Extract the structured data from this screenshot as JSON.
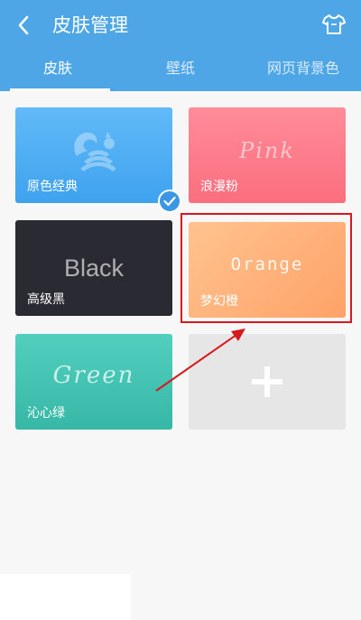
{
  "header": {
    "title": "皮肤管理",
    "back_icon": "chevron-left-icon",
    "shirt_icon": "tshirt-icon",
    "bg_color": "#4ea6e7"
  },
  "tabs": [
    {
      "label": "皮肤",
      "active": true
    },
    {
      "label": "壁纸",
      "active": false
    },
    {
      "label": "网页背景色",
      "active": false
    }
  ],
  "skins": [
    {
      "label": "原色经典",
      "art": "",
      "selected": true,
      "color": "#4ea8f2"
    },
    {
      "label": "浪漫粉",
      "art": "Pink",
      "selected": false,
      "color": "#fb7b8a"
    },
    {
      "label": "高级黑",
      "art": "Black",
      "selected": false,
      "color": "#2a2a33"
    },
    {
      "label": "梦幻橙",
      "art": "Orange",
      "selected": false,
      "color": "#ffb07a"
    },
    {
      "label": "沁心绿",
      "art": "Green",
      "selected": false,
      "color": "#44c3b2"
    }
  ],
  "add_card": {
    "icon": "plus-icon"
  },
  "annotation": {
    "color": "#d7191e"
  }
}
